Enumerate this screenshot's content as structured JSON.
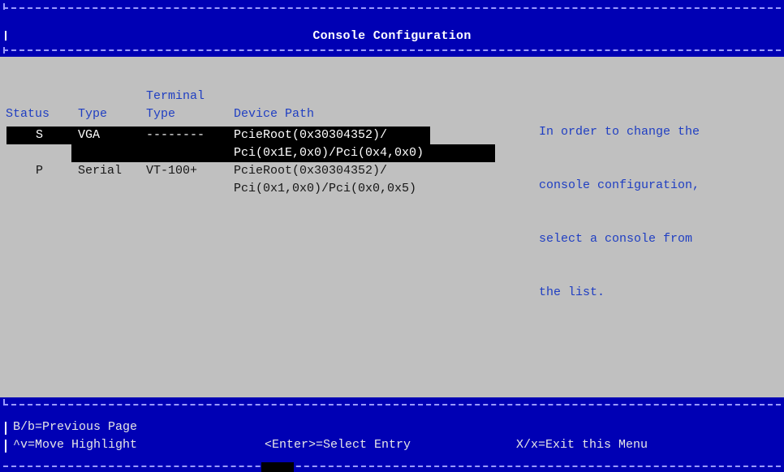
{
  "header": {
    "title": "Console Configuration"
  },
  "columns": {
    "status": "Status",
    "type": "Type",
    "terminal_type_line1": "Terminal",
    "terminal_type_line2": "Type",
    "device_path": "Device Path"
  },
  "consoles": [
    {
      "status": "S",
      "type": "VGA",
      "terminal_type": "--------",
      "device_path_line1": "PcieRoot(0x30304352)/",
      "device_path_line2": "Pci(0x1E,0x0)/Pci(0x4,0x0)",
      "selected": true
    },
    {
      "status": "P",
      "type": "Serial",
      "terminal_type": "VT-100+",
      "device_path_line1": "PcieRoot(0x30304352)/",
      "device_path_line2": "Pci(0x1,0x0)/Pci(0x0,0x5)",
      "selected": false
    }
  ],
  "help": {
    "line1": "In order to change the",
    "line2": "console configuration,",
    "line3": "select a console from",
    "line4": "the list."
  },
  "footer": {
    "prev_page": "B/b=Previous Page",
    "move_highlight": "^v=Move Highlight",
    "select_entry": "<Enter>=Select Entry",
    "exit_menu": "X/x=Exit this Menu"
  },
  "colors": {
    "header_bg": "#0000b4",
    "body_bg": "#c0c0c0",
    "label_text": "#1f3ec2",
    "highlight_bg": "#000000"
  }
}
